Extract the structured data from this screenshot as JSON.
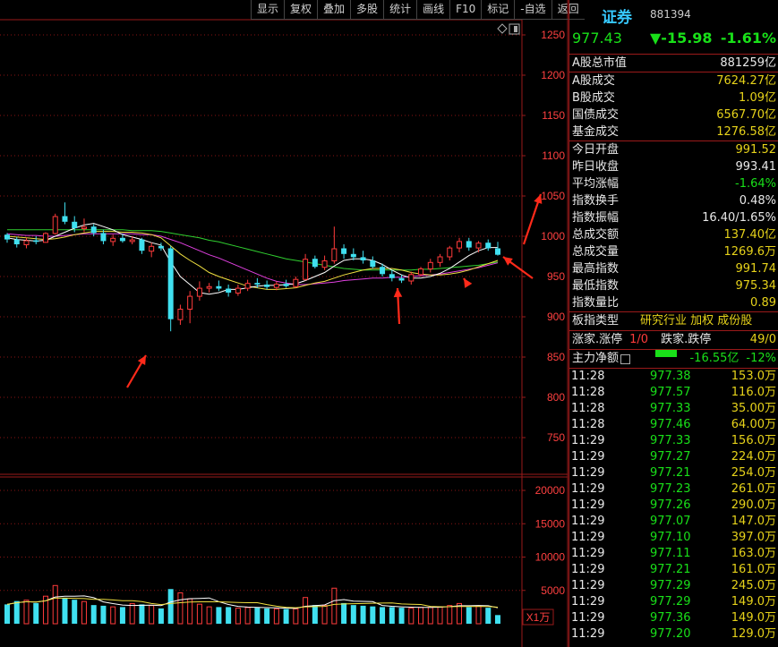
{
  "toolbar": [
    "显示",
    "复权",
    "叠加",
    "多股",
    "统计",
    "画线",
    "F10",
    "标记",
    "-自选",
    "返回"
  ],
  "volume_unit": "X1万",
  "header": {
    "name": "证券",
    "code": "881394",
    "price": "977.43",
    "change": "▼-15.98",
    "pct": "-1.61%"
  },
  "market_cap": {
    "label": "A股总市值",
    "value": "881259亿"
  },
  "turnover": [
    {
      "label": "A股成交",
      "value": "7624.27亿"
    },
    {
      "label": "B股成交",
      "value": "1.09亿"
    },
    {
      "label": "国债成交",
      "value": "6567.70亿"
    },
    {
      "label": "基金成交",
      "value": "1276.58亿"
    }
  ],
  "stats": [
    {
      "label": "今日开盘",
      "value": "991.52",
      "color": "yel"
    },
    {
      "label": "昨日收盘",
      "value": "993.41",
      "color": "wht"
    },
    {
      "label": "平均涨幅",
      "value": "-1.64%",
      "color": "grn"
    },
    {
      "label": "指数换手",
      "value": "0.48%",
      "color": "wht"
    },
    {
      "label": "指数振幅",
      "value": "16.40/1.65%",
      "color": "wht"
    },
    {
      "label": "总成交额",
      "value": "137.40亿",
      "color": "yel"
    },
    {
      "label": "总成交量",
      "value": "1269.6万",
      "color": "yel"
    },
    {
      "label": "最高指数",
      "value": "991.74",
      "color": "yel"
    },
    {
      "label": "最低指数",
      "value": "975.34",
      "color": "yel"
    },
    {
      "label": "指数量比",
      "value": "0.89",
      "color": "yel"
    }
  ],
  "sector": {
    "label": "板指类型",
    "value": "研究行业 加权 成份股"
  },
  "limits": {
    "up_label": "涨家.涨停",
    "up_value": "1/0",
    "down_label": "跌家.跌停",
    "down_value": "49/0"
  },
  "main_flow": {
    "label": "主力净额",
    "amount": "-16.55亿",
    "pct": "-12%"
  },
  "trades": [
    {
      "time": "11:28",
      "price": "977.38",
      "vol": "153.0万"
    },
    {
      "time": "11:28",
      "price": "977.57",
      "vol": "116.0万"
    },
    {
      "time": "11:28",
      "price": "977.33",
      "vol": "35.00万"
    },
    {
      "time": "11:28",
      "price": "977.46",
      "vol": "64.00万"
    },
    {
      "time": "11:29",
      "price": "977.33",
      "vol": "156.0万"
    },
    {
      "time": "11:29",
      "price": "977.27",
      "vol": "224.0万"
    },
    {
      "time": "11:29",
      "price": "977.21",
      "vol": "254.0万"
    },
    {
      "time": "11:29",
      "price": "977.23",
      "vol": "261.0万"
    },
    {
      "time": "11:29",
      "price": "977.26",
      "vol": "290.0万"
    },
    {
      "time": "11:29",
      "price": "977.07",
      "vol": "147.0万"
    },
    {
      "time": "11:29",
      "price": "977.10",
      "vol": "397.0万"
    },
    {
      "time": "11:29",
      "price": "977.11",
      "vol": "163.0万"
    },
    {
      "time": "11:29",
      "price": "977.21",
      "vol": "161.0万"
    },
    {
      "time": "11:29",
      "price": "977.29",
      "vol": "245.0万"
    },
    {
      "time": "11:29",
      "price": "977.29",
      "vol": "149.0万"
    },
    {
      "time": "11:29",
      "price": "977.36",
      "vol": "149.0万"
    },
    {
      "time": "11:29",
      "price": "977.20",
      "vol": "129.0万"
    }
  ],
  "colors": {
    "up": "#ff3b3b",
    "down": "#40e0f0",
    "grid": "#8a1515",
    "ma5": "#ffffff",
    "ma10": "#f0e040",
    "ma20": "#e040e0",
    "ma60": "#30d030"
  },
  "chart_data": {
    "type": "candlestick",
    "y_ticks": [
      1250,
      1200,
      1150,
      1100,
      1050,
      1000,
      950,
      900,
      850,
      800,
      750
    ],
    "vol_ticks": [
      20000,
      15000,
      10000,
      5000
    ],
    "ylim": [
      700,
      1260
    ],
    "vol_ylim": [
      0,
      21500
    ],
    "candles": [
      [
        1002,
        1004,
        992,
        996
      ],
      [
        996,
        999,
        986,
        990
      ],
      [
        990,
        998,
        985,
        995
      ],
      [
        995,
        1000,
        990,
        993
      ],
      [
        993,
        1005,
        992,
        1004
      ],
      [
        1004,
        1028,
        1002,
        1025
      ],
      [
        1025,
        1042,
        1015,
        1018
      ],
      [
        1018,
        1025,
        1005,
        1010
      ],
      [
        1010,
        1022,
        1005,
        1012
      ],
      [
        1012,
        1015,
        1000,
        1004
      ],
      [
        1004,
        1008,
        990,
        994
      ],
      [
        994,
        1002,
        988,
        998
      ],
      [
        998,
        1003,
        992,
        994
      ],
      [
        994,
        1000,
        990,
        996
      ],
      [
        996,
        998,
        978,
        982
      ],
      [
        982,
        992,
        974,
        988
      ],
      [
        988,
        992,
        982,
        985
      ],
      [
        985,
        988,
        882,
        897
      ],
      [
        897,
        915,
        890,
        910
      ],
      [
        910,
        932,
        892,
        926
      ],
      [
        926,
        944,
        920,
        936
      ],
      [
        936,
        942,
        930,
        938
      ],
      [
        938,
        945,
        932,
        935
      ],
      [
        935,
        940,
        925,
        930
      ],
      [
        930,
        940,
        926,
        936
      ],
      [
        936,
        946,
        932,
        942
      ],
      [
        942,
        948,
        936,
        940
      ],
      [
        940,
        945,
        934,
        937
      ],
      [
        937,
        944,
        933,
        941
      ],
      [
        941,
        946,
        936,
        938
      ],
      [
        938,
        950,
        936,
        947
      ],
      [
        947,
        978,
        945,
        972
      ],
      [
        972,
        976,
        960,
        962
      ],
      [
        962,
        976,
        958,
        970
      ],
      [
        970,
        1012,
        966,
        985
      ],
      [
        985,
        990,
        972,
        978
      ],
      [
        978,
        985,
        970,
        974
      ],
      [
        974,
        982,
        966,
        970
      ],
      [
        970,
        975,
        960,
        962
      ],
      [
        962,
        966,
        950,
        953
      ],
      [
        953,
        958,
        944,
        948
      ],
      [
        948,
        952,
        942,
        945
      ],
      [
        945,
        956,
        940,
        953
      ],
      [
        953,
        962,
        950,
        960
      ],
      [
        960,
        972,
        955,
        968
      ],
      [
        968,
        978,
        962,
        975
      ],
      [
        975,
        988,
        970,
        986
      ],
      [
        986,
        998,
        980,
        994
      ],
      [
        994,
        998,
        982,
        986
      ],
      [
        986,
        994,
        980,
        992
      ],
      [
        992,
        996,
        982,
        985
      ],
      [
        985,
        993,
        976,
        977
      ]
    ],
    "volumes": [
      2900,
      3400,
      3600,
      3100,
      4200,
      5800,
      3900,
      3600,
      3400,
      2800,
      2700,
      2600,
      2500,
      3100,
      2900,
      2800,
      2300,
      5200,
      4700,
      3800,
      3000,
      2600,
      2500,
      2500,
      2400,
      2500,
      2400,
      2300,
      2300,
      2200,
      2300,
      4000,
      2800,
      2800,
      5400,
      3100,
      2800,
      2700,
      2600,
      2500,
      2500,
      2400,
      2400,
      2500,
      2500,
      2600,
      2800,
      3100,
      2500,
      2700,
      2400,
      1300
    ],
    "ma5": [
      998,
      996,
      995,
      994,
      995,
      1000,
      1005,
      1010,
      1014,
      1016,
      1012,
      1008,
      1002,
      999,
      996,
      992,
      989,
      968,
      950,
      940,
      930,
      928,
      930,
      934,
      934,
      936,
      938,
      939,
      939,
      940,
      941,
      945,
      950,
      955,
      963,
      970,
      972,
      972,
      970,
      965,
      958,
      952,
      948,
      948,
      950,
      954,
      960,
      968,
      976,
      982,
      986,
      986
    ],
    "ma10": [
      1000,
      999,
      998,
      997,
      996,
      997,
      999,
      1002,
      1004,
      1006,
      1006,
      1006,
      1005,
      1005,
      1004,
      1002,
      998,
      988,
      978,
      970,
      963,
      955,
      950,
      946,
      942,
      938,
      936,
      934,
      934,
      935,
      936,
      939,
      942,
      944,
      948,
      952,
      955,
      958,
      960,
      960,
      960,
      958,
      955,
      953,
      952,
      952,
      953,
      955,
      958,
      962,
      966,
      970
    ],
    "ma20": [
      1003,
      1002,
      1001,
      1001,
      1000,
      1000,
      1001,
      1002,
      1003,
      1003,
      1003,
      1003,
      1003,
      1003,
      1002,
      1002,
      1000,
      996,
      992,
      987,
      982,
      977,
      973,
      968,
      963,
      958,
      953,
      948,
      944,
      942,
      940,
      940,
      941,
      942,
      943,
      945,
      946,
      947,
      948,
      948,
      949,
      949,
      950,
      951,
      952,
      953,
      955,
      957,
      959,
      961,
      964,
      967
    ],
    "ma60": [
      1008,
      1008,
      1008,
      1008,
      1008,
      1008,
      1008,
      1008,
      1008,
      1008,
      1008,
      1008,
      1008,
      1007,
      1007,
      1007,
      1006,
      1004,
      1002,
      1000,
      998,
      995,
      993,
      990,
      987,
      984,
      981,
      978,
      975,
      972,
      970,
      968,
      966,
      964,
      962,
      960,
      959,
      958,
      958,
      958,
      958,
      958,
      958,
      959,
      959,
      960,
      961,
      962,
      963,
      964,
      966,
      968
    ]
  }
}
